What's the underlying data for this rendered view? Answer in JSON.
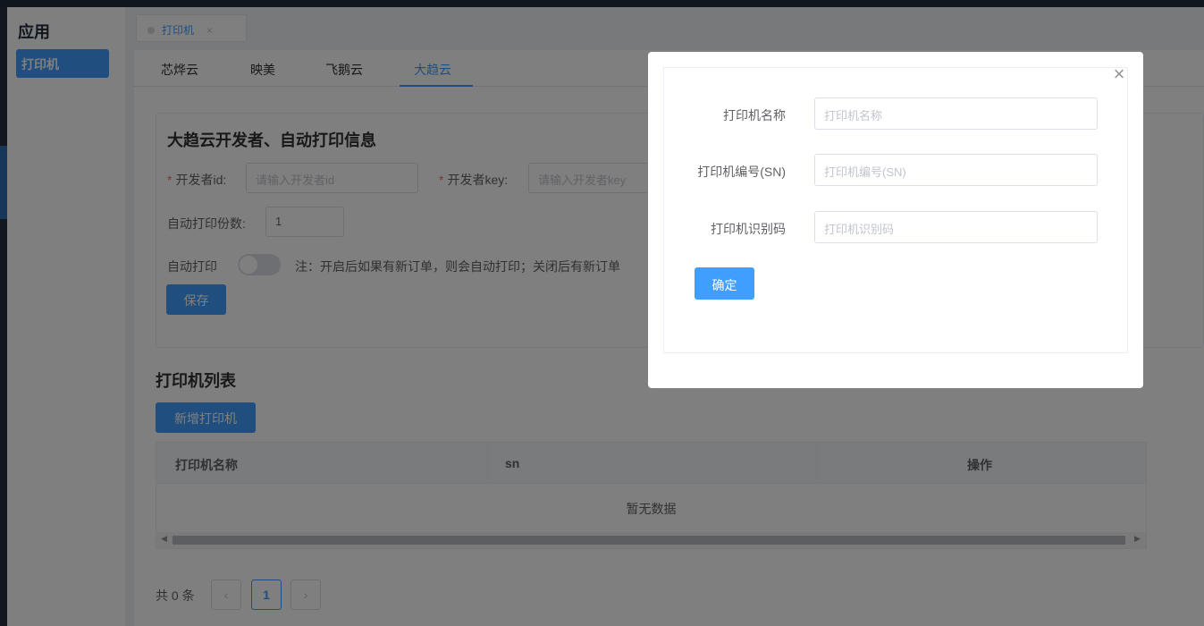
{
  "app_sidebar": {
    "title": "应用",
    "items": [
      {
        "label": "打印机",
        "active": true
      }
    ]
  },
  "page_tabs": [
    {
      "label": "打印机",
      "close": "×"
    }
  ],
  "sub_tabs": [
    "芯烨云",
    "映美",
    "飞鹅云",
    "大趋云"
  ],
  "active_sub_tab": "大趋云",
  "developer_card": {
    "title": "大趋云开发者、自动打印信息",
    "required_mark": "*",
    "dev_id_label": "开发者id:",
    "dev_id_placeholder": "请输入开发者id",
    "dev_key_label": "开发者key:",
    "dev_key_placeholder": "请输入开发者key",
    "copies_label": "自动打印份数:",
    "copies_value": "1",
    "auto_print_label": "自动打印",
    "auto_print_on": false,
    "note": "注：开启后如果有新订单，则会自动打印；关闭后有新订单",
    "save_label": "保存"
  },
  "printer_list": {
    "title": "打印机列表",
    "add_label": "新增打印机",
    "columns": [
      "打印机名称",
      "sn",
      "操作"
    ],
    "empty_text": "暂无数据",
    "scroll_left": "◀",
    "scroll_right": "▶"
  },
  "pagination": {
    "total": "共 0 条",
    "prev": "‹",
    "current": "1",
    "next": "›"
  },
  "modal": {
    "close_icon": "×",
    "fields": [
      {
        "label": "打印机名称",
        "placeholder": "打印机名称"
      },
      {
        "label": "打印机编号(SN)",
        "placeholder": "打印机编号(SN)"
      },
      {
        "label": "打印机识别码",
        "placeholder": "打印机识别码"
      }
    ],
    "confirm_label": "确定"
  },
  "colors": {
    "primary": "#409eff",
    "overlay": "rgba(0,0,0,0.5)",
    "danger": "#f56c6c"
  }
}
